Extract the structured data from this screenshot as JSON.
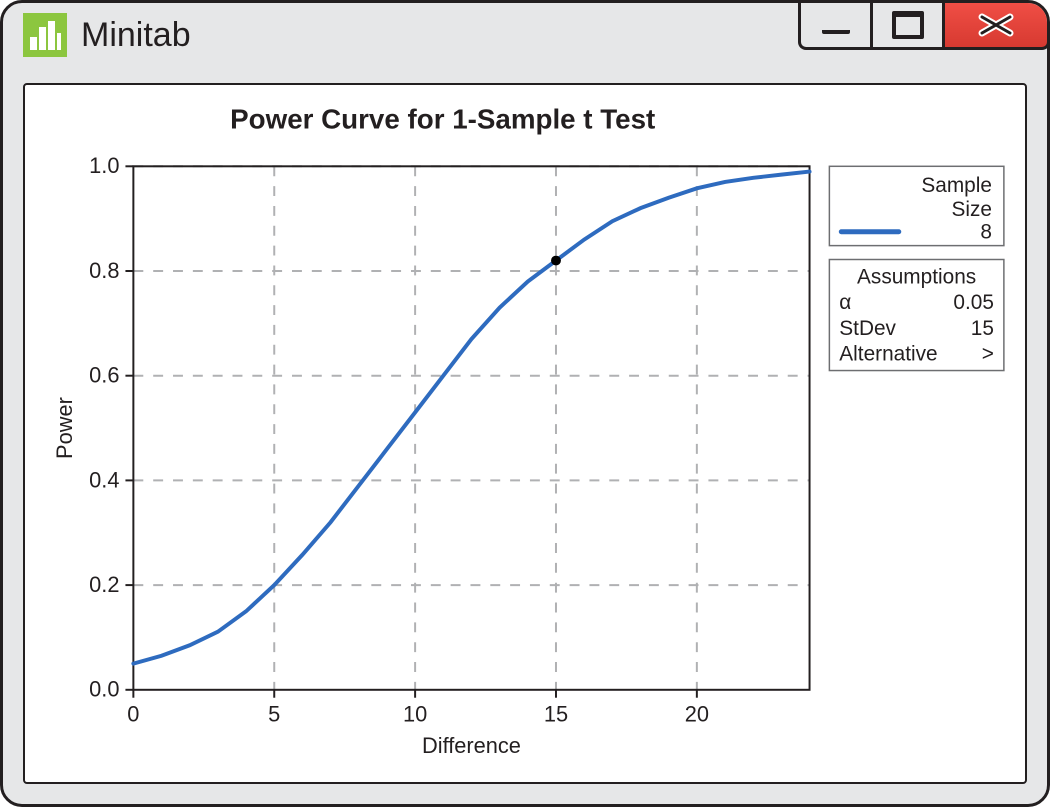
{
  "app": {
    "title": "Minitab"
  },
  "window_controls": {
    "minimize": "minimize",
    "maximize": "maximize",
    "close": "close"
  },
  "chart_data": {
    "type": "line",
    "title": "Power Curve for 1-Sample t Test",
    "xlabel": "Difference",
    "ylabel": "Power",
    "xlim": [
      0,
      24
    ],
    "ylim": [
      0,
      1.0
    ],
    "x_ticks": [
      0,
      5,
      10,
      15,
      20
    ],
    "y_ticks": [
      0.0,
      0.2,
      0.4,
      0.6,
      0.8,
      1.0
    ],
    "series": [
      {
        "name": "Sample Size 8",
        "sample_size": 8,
        "x": [
          0,
          1,
          2,
          3,
          4,
          5,
          6,
          7,
          8,
          9,
          10,
          11,
          12,
          13,
          14,
          15,
          16,
          17,
          18,
          19,
          20,
          21,
          22,
          23,
          24
        ],
        "values": [
          0.05,
          0.065,
          0.085,
          0.111,
          0.15,
          0.2,
          0.258,
          0.32,
          0.39,
          0.46,
          0.53,
          0.6,
          0.67,
          0.73,
          0.78,
          0.82,
          0.86,
          0.895,
          0.92,
          0.94,
          0.958,
          0.97,
          0.978,
          0.984,
          0.99
        ]
      }
    ],
    "marker": {
      "x": 15,
      "y": 0.82
    },
    "legend": {
      "title_line1": "Sample",
      "title_line2": "Size",
      "entries": [
        {
          "label": "8"
        }
      ]
    },
    "assumptions": {
      "heading": "Assumptions",
      "rows": [
        {
          "label": "α",
          "value": "0.05"
        },
        {
          "label": "StDev",
          "value": "15"
        },
        {
          "label": "Alternative",
          "value": ">"
        }
      ]
    }
  },
  "colors": {
    "curve": "#2e6bbf",
    "window_bg": "#e6e7e8",
    "close_btn": "#e8483f"
  }
}
